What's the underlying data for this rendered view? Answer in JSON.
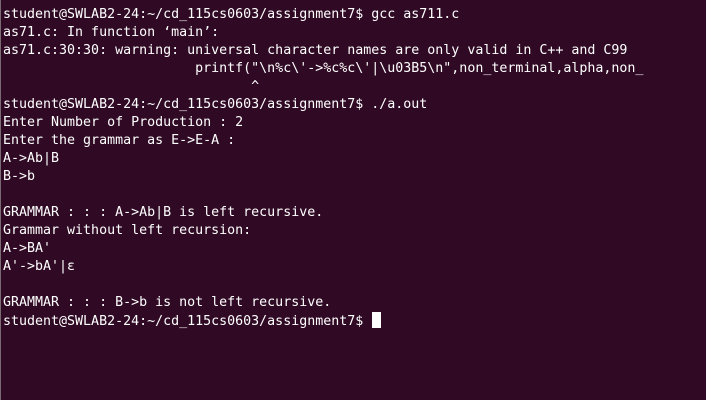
{
  "terminal": {
    "lines": [
      "student@SWLAB2-24:~/cd_115cs0603/assignment7$ gcc as711.c",
      "as71.c: In function ‘main’:",
      "as71.c:30:30: warning: universal character names are only valid in C++ and C99",
      "                        printf(\"\\n%c\\'->%c%c\\'|\\u03B5\\n\",non_terminal,alpha,non_",
      "                               ^",
      "student@SWLAB2-24:~/cd_115cs0603/assignment7$ ./a.out",
      "Enter Number of Production : 2",
      "Enter the grammar as E->E-A :",
      "A->Ab|B",
      "B->b",
      "",
      "GRAMMAR : : : A->Ab|B is left recursive.",
      "Grammar without left recursion:",
      "A->BA'",
      "A'->bA'|ε",
      "",
      "GRAMMAR : : : B->b is not left recursive.",
      "student@SWLAB2-24:~/cd_115cs0603/assignment7$ "
    ]
  }
}
